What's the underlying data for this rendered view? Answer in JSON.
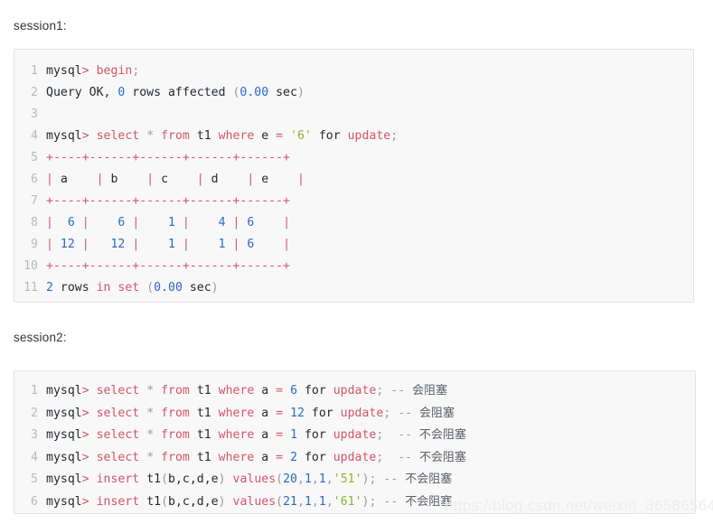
{
  "page": {
    "background_color": "#ffffff",
    "watermark": "https://blog.csdn.net/weixin_36586564"
  },
  "theme": {
    "code_background": "#f8f8f8",
    "code_border": "#e3e3e3",
    "line_number_color": "#b9b9b9",
    "keyword_color": "#d6546a",
    "number_color": "#2a6bbf",
    "string_color": "#8cb533",
    "punctuation_color": "#9a9a9a",
    "comment_color": "#9b9b9b",
    "plain_color": "#24292e"
  },
  "sections": [
    {
      "id": "session1",
      "label": "session1:",
      "lines": [
        {
          "n": "1",
          "tokens": [
            {
              "t": "plain",
              "v": "mysql"
            },
            {
              "t": "kw",
              "v": ">"
            },
            {
              "t": "plain",
              "v": " "
            },
            {
              "t": "kw",
              "v": "begin"
            },
            {
              "t": "punc",
              "v": ";"
            }
          ]
        },
        {
          "n": "2",
          "tokens": [
            {
              "t": "plain",
              "v": "Query OK, "
            },
            {
              "t": "num",
              "v": "0"
            },
            {
              "t": "plain",
              "v": " rows affected "
            },
            {
              "t": "punc",
              "v": "("
            },
            {
              "t": "num",
              "v": "0.00"
            },
            {
              "t": "plain",
              "v": " sec"
            },
            {
              "t": "punc",
              "v": ")"
            }
          ]
        },
        {
          "n": "3",
          "tokens": [
            {
              "t": "plain",
              "v": ""
            }
          ]
        },
        {
          "n": "4",
          "tokens": [
            {
              "t": "plain",
              "v": "mysql"
            },
            {
              "t": "kw",
              "v": ">"
            },
            {
              "t": "plain",
              "v": " "
            },
            {
              "t": "kw",
              "v": "select"
            },
            {
              "t": "plain",
              "v": " "
            },
            {
              "t": "punc",
              "v": "*"
            },
            {
              "t": "plain",
              "v": " "
            },
            {
              "t": "kw",
              "v": "from"
            },
            {
              "t": "plain",
              "v": " t1 "
            },
            {
              "t": "kw",
              "v": "where"
            },
            {
              "t": "plain",
              "v": " e "
            },
            {
              "t": "kw",
              "v": "="
            },
            {
              "t": "plain",
              "v": " "
            },
            {
              "t": "str",
              "v": "'6'"
            },
            {
              "t": "plain",
              "v": " for "
            },
            {
              "t": "kw",
              "v": "update"
            },
            {
              "t": "punc",
              "v": ";"
            }
          ]
        },
        {
          "n": "5",
          "tokens": [
            {
              "t": "tbl",
              "v": "+----+------+------+------+------+"
            }
          ]
        },
        {
          "n": "6",
          "tokens": [
            {
              "t": "tbl",
              "v": "| "
            },
            {
              "t": "hdr",
              "v": "a"
            },
            {
              "t": "tbl",
              "v": "    | "
            },
            {
              "t": "hdr",
              "v": "b"
            },
            {
              "t": "tbl",
              "v": "    | "
            },
            {
              "t": "hdr",
              "v": "c"
            },
            {
              "t": "tbl",
              "v": "    | "
            },
            {
              "t": "hdr",
              "v": "d"
            },
            {
              "t": "tbl",
              "v": "    | "
            },
            {
              "t": "hdr",
              "v": "e"
            },
            {
              "t": "tbl",
              "v": "    |"
            }
          ]
        },
        {
          "n": "7",
          "tokens": [
            {
              "t": "tbl",
              "v": "+----+------+------+------+------+"
            }
          ]
        },
        {
          "n": "8",
          "tokens": [
            {
              "t": "tbl",
              "v": "|  "
            },
            {
              "t": "num",
              "v": "6"
            },
            {
              "t": "tbl",
              "v": " |    "
            },
            {
              "t": "num",
              "v": "6"
            },
            {
              "t": "tbl",
              "v": " |    "
            },
            {
              "t": "num",
              "v": "1"
            },
            {
              "t": "tbl",
              "v": " |    "
            },
            {
              "t": "num",
              "v": "4"
            },
            {
              "t": "tbl",
              "v": " | "
            },
            {
              "t": "num",
              "v": "6"
            },
            {
              "t": "tbl",
              "v": "    |"
            }
          ]
        },
        {
          "n": "9",
          "tokens": [
            {
              "t": "tbl",
              "v": "| "
            },
            {
              "t": "num",
              "v": "12"
            },
            {
              "t": "tbl",
              "v": " |   "
            },
            {
              "t": "num",
              "v": "12"
            },
            {
              "t": "tbl",
              "v": " |    "
            },
            {
              "t": "num",
              "v": "1"
            },
            {
              "t": "tbl",
              "v": " |    "
            },
            {
              "t": "num",
              "v": "1"
            },
            {
              "t": "tbl",
              "v": " | "
            },
            {
              "t": "num",
              "v": "6"
            },
            {
              "t": "tbl",
              "v": "    |"
            }
          ]
        },
        {
          "n": "10",
          "tokens": [
            {
              "t": "tbl",
              "v": "+----+------+------+------+------+"
            }
          ]
        },
        {
          "n": "11",
          "tokens": [
            {
              "t": "num",
              "v": "2"
            },
            {
              "t": "plain",
              "v": " rows "
            },
            {
              "t": "kw",
              "v": "in set"
            },
            {
              "t": "plain",
              "v": " "
            },
            {
              "t": "punc",
              "v": "("
            },
            {
              "t": "num",
              "v": "0.00"
            },
            {
              "t": "plain",
              "v": " sec"
            },
            {
              "t": "punc",
              "v": ")"
            }
          ]
        }
      ]
    },
    {
      "id": "session2",
      "label": "session2:",
      "lines": [
        {
          "n": "1",
          "tokens": [
            {
              "t": "plain",
              "v": "mysql"
            },
            {
              "t": "kw",
              "v": ">"
            },
            {
              "t": "plain",
              "v": " "
            },
            {
              "t": "kw",
              "v": "select"
            },
            {
              "t": "plain",
              "v": " "
            },
            {
              "t": "punc",
              "v": "*"
            },
            {
              "t": "plain",
              "v": " "
            },
            {
              "t": "kw",
              "v": "from"
            },
            {
              "t": "plain",
              "v": " t1 "
            },
            {
              "t": "kw",
              "v": "where"
            },
            {
              "t": "plain",
              "v": " a "
            },
            {
              "t": "kw",
              "v": "="
            },
            {
              "t": "plain",
              "v": " "
            },
            {
              "t": "num",
              "v": "6"
            },
            {
              "t": "plain",
              "v": " for "
            },
            {
              "t": "kw",
              "v": "update"
            },
            {
              "t": "punc",
              "v": ";"
            },
            {
              "t": "cmt",
              "v": " -- "
            },
            {
              "t": "cjk",
              "v": "会阻塞"
            }
          ]
        },
        {
          "n": "2",
          "tokens": [
            {
              "t": "plain",
              "v": "mysql"
            },
            {
              "t": "kw",
              "v": ">"
            },
            {
              "t": "plain",
              "v": " "
            },
            {
              "t": "kw",
              "v": "select"
            },
            {
              "t": "plain",
              "v": " "
            },
            {
              "t": "punc",
              "v": "*"
            },
            {
              "t": "plain",
              "v": " "
            },
            {
              "t": "kw",
              "v": "from"
            },
            {
              "t": "plain",
              "v": " t1 "
            },
            {
              "t": "kw",
              "v": "where"
            },
            {
              "t": "plain",
              "v": " a "
            },
            {
              "t": "kw",
              "v": "="
            },
            {
              "t": "plain",
              "v": " "
            },
            {
              "t": "num",
              "v": "12"
            },
            {
              "t": "plain",
              "v": " for "
            },
            {
              "t": "kw",
              "v": "update"
            },
            {
              "t": "punc",
              "v": ";"
            },
            {
              "t": "cmt",
              "v": " -- "
            },
            {
              "t": "cjk",
              "v": "会阻塞"
            }
          ]
        },
        {
          "n": "3",
          "tokens": [
            {
              "t": "plain",
              "v": "mysql"
            },
            {
              "t": "kw",
              "v": ">"
            },
            {
              "t": "plain",
              "v": " "
            },
            {
              "t": "kw",
              "v": "select"
            },
            {
              "t": "plain",
              "v": " "
            },
            {
              "t": "punc",
              "v": "*"
            },
            {
              "t": "plain",
              "v": " "
            },
            {
              "t": "kw",
              "v": "from"
            },
            {
              "t": "plain",
              "v": " t1 "
            },
            {
              "t": "kw",
              "v": "where"
            },
            {
              "t": "plain",
              "v": " a "
            },
            {
              "t": "kw",
              "v": "="
            },
            {
              "t": "plain",
              "v": " "
            },
            {
              "t": "num",
              "v": "1"
            },
            {
              "t": "plain",
              "v": " for "
            },
            {
              "t": "kw",
              "v": "update"
            },
            {
              "t": "punc",
              "v": ";"
            },
            {
              "t": "cmt",
              "v": "  -- "
            },
            {
              "t": "cjk",
              "v": "不会阻塞"
            }
          ]
        },
        {
          "n": "4",
          "tokens": [
            {
              "t": "plain",
              "v": "mysql"
            },
            {
              "t": "kw",
              "v": ">"
            },
            {
              "t": "plain",
              "v": " "
            },
            {
              "t": "kw",
              "v": "select"
            },
            {
              "t": "plain",
              "v": " "
            },
            {
              "t": "punc",
              "v": "*"
            },
            {
              "t": "plain",
              "v": " "
            },
            {
              "t": "kw",
              "v": "from"
            },
            {
              "t": "plain",
              "v": " t1 "
            },
            {
              "t": "kw",
              "v": "where"
            },
            {
              "t": "plain",
              "v": " a "
            },
            {
              "t": "kw",
              "v": "="
            },
            {
              "t": "plain",
              "v": " "
            },
            {
              "t": "num",
              "v": "2"
            },
            {
              "t": "plain",
              "v": " for "
            },
            {
              "t": "kw",
              "v": "update"
            },
            {
              "t": "punc",
              "v": ";"
            },
            {
              "t": "cmt",
              "v": "  -- "
            },
            {
              "t": "cjk",
              "v": "不会阻塞"
            }
          ]
        },
        {
          "n": "5",
          "tokens": [
            {
              "t": "plain",
              "v": "mysql"
            },
            {
              "t": "kw",
              "v": ">"
            },
            {
              "t": "plain",
              "v": " "
            },
            {
              "t": "kw",
              "v": "insert"
            },
            {
              "t": "plain",
              "v": " t1"
            },
            {
              "t": "punc",
              "v": "("
            },
            {
              "t": "plain",
              "v": "b,c,d,e"
            },
            {
              "t": "punc",
              "v": ")"
            },
            {
              "t": "plain",
              "v": " "
            },
            {
              "t": "kw",
              "v": "values"
            },
            {
              "t": "punc",
              "v": "("
            },
            {
              "t": "num",
              "v": "20"
            },
            {
              "t": "punc",
              "v": ","
            },
            {
              "t": "num",
              "v": "1"
            },
            {
              "t": "punc",
              "v": ","
            },
            {
              "t": "num",
              "v": "1"
            },
            {
              "t": "punc",
              "v": ","
            },
            {
              "t": "str",
              "v": "'51'"
            },
            {
              "t": "punc",
              "v": ")"
            },
            {
              "t": "punc",
              "v": ";"
            },
            {
              "t": "cmt",
              "v": " -- "
            },
            {
              "t": "cjk",
              "v": "不会阻塞"
            }
          ]
        },
        {
          "n": "6",
          "tokens": [
            {
              "t": "plain",
              "v": "mysql"
            },
            {
              "t": "kw",
              "v": ">"
            },
            {
              "t": "plain",
              "v": " "
            },
            {
              "t": "kw",
              "v": "insert"
            },
            {
              "t": "plain",
              "v": " t1"
            },
            {
              "t": "punc",
              "v": "("
            },
            {
              "t": "plain",
              "v": "b,c,d,e"
            },
            {
              "t": "punc",
              "v": ")"
            },
            {
              "t": "plain",
              "v": " "
            },
            {
              "t": "kw",
              "v": "values"
            },
            {
              "t": "punc",
              "v": "("
            },
            {
              "t": "num",
              "v": "21"
            },
            {
              "t": "punc",
              "v": ","
            },
            {
              "t": "num",
              "v": "1"
            },
            {
              "t": "punc",
              "v": ","
            },
            {
              "t": "num",
              "v": "1"
            },
            {
              "t": "punc",
              "v": ","
            },
            {
              "t": "str",
              "v": "'61'"
            },
            {
              "t": "punc",
              "v": ")"
            },
            {
              "t": "punc",
              "v": ";"
            },
            {
              "t": "cmt",
              "v": " -- "
            },
            {
              "t": "cjk",
              "v": "不会阻塞"
            }
          ]
        }
      ]
    }
  ]
}
